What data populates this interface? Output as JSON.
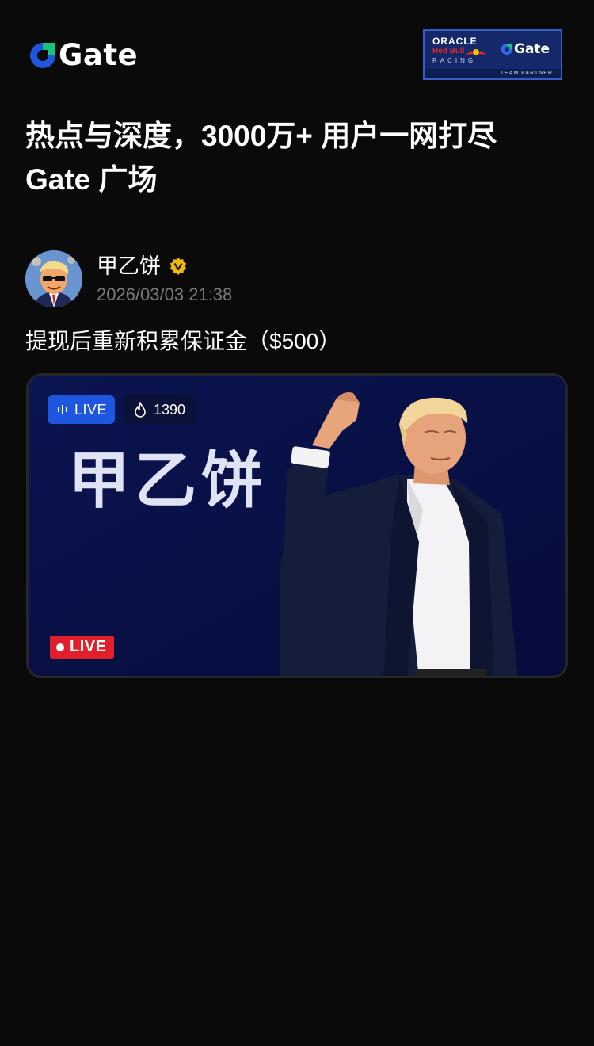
{
  "header": {
    "brand_name": "Gate",
    "partner": {
      "oracle": "ORACLE",
      "redbull": "Red Bull",
      "racing": "RACING",
      "gate": "Gate",
      "footer": "TEAM PARTNER"
    }
  },
  "headline": {
    "line1": "热点与深度，3000万+ 用户一网打尽",
    "line2": "Gate 广场"
  },
  "post": {
    "author": "甲乙饼",
    "verified": true,
    "timestamp": "2026/03/03 21:38",
    "text": "提现后重新积累保证金（$500）",
    "live_card": {
      "live_label": "LIVE",
      "viewer_count": "1390",
      "title": "甲乙饼",
      "badge_label": "LIVE"
    }
  },
  "colors": {
    "background": "#0a0a0a",
    "brand_blue": "#1f56e0",
    "brand_green": "#18c37d",
    "live_red": "#e01f2a",
    "verified_gold": "#f0b90b",
    "card_navy": "#09124a"
  },
  "icons": [
    "gate-logo-icon",
    "verified-icon",
    "live-bars-icon",
    "flame-icon",
    "red-dot-icon"
  ]
}
